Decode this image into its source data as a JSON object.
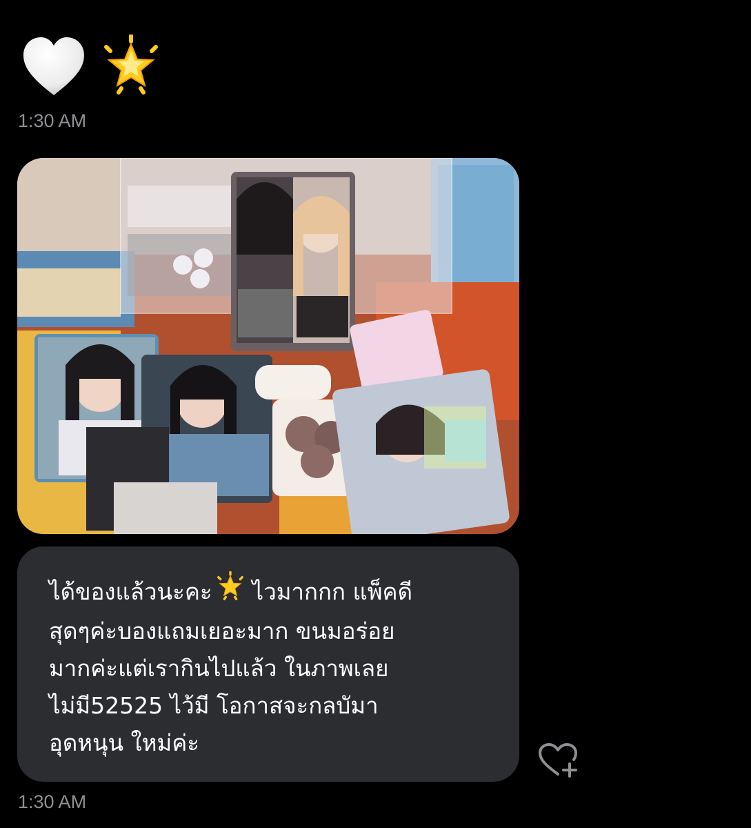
{
  "messages": [
    {
      "type": "emoji",
      "emojis": [
        "white-heart-icon",
        "glowing-star-icon"
      ],
      "timestamp": "1:30 AM"
    },
    {
      "type": "photo",
      "alt_subject": "photocard collection"
    },
    {
      "type": "text",
      "lines": [
        "ได้ของแล้วนะคะ",
        "ไวมากกก แพ็คดี",
        "สุดๆค่ะบองแถมเยอะมาก ขนมอร่อย",
        "มากค่ะแต่เรากินไปแล้ว ในภาพเลย",
        "ไม่มี52525 ไว้มี โอกาสจะกลบัมา",
        "อุดหนุน ใหม่ค่ะ"
      ],
      "inline_emoji": "glowing-star-icon",
      "timestamp": "1:30 AM"
    }
  ],
  "react_button_icon": "heart-plus-icon",
  "colors": {
    "background": "#000000",
    "bubble": "#2c2d31",
    "timestamp": "#8e8e93",
    "text": "#ffffff",
    "star": "#ffcc1f"
  }
}
